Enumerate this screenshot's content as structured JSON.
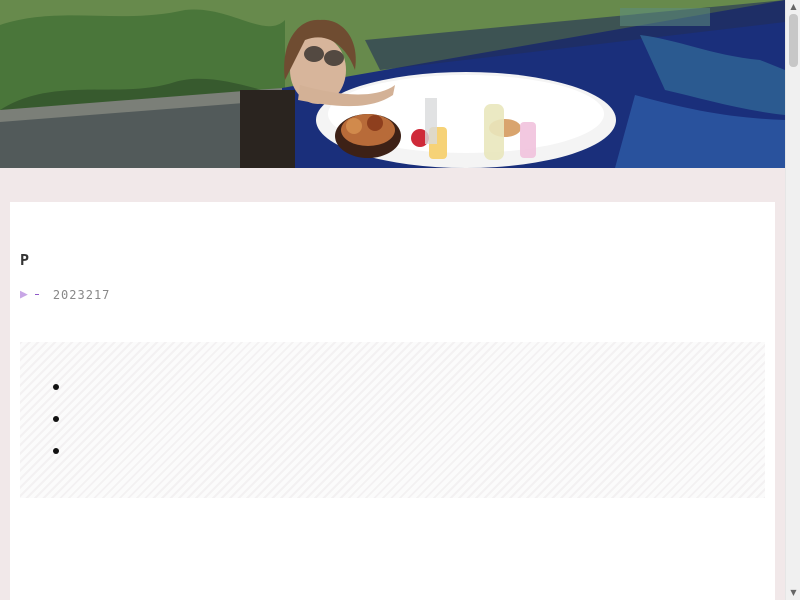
{
  "breadcrumb": "",
  "post": {
    "title_line1": "",
    "title_line2": "P",
    "category": "",
    "date": "2023217"
  },
  "toc": {
    "items": [
      "",
      "",
      ""
    ]
  },
  "section": {
    "heading": ""
  },
  "colors": {
    "page_bg": "#f1e8e9",
    "card_bg": "#ffffff",
    "accent": "#d8a9ef"
  },
  "icons": {
    "meta_arrow": "play-icon",
    "scroll_up": "chevron-up-icon",
    "scroll_down": "chevron-down-icon"
  }
}
